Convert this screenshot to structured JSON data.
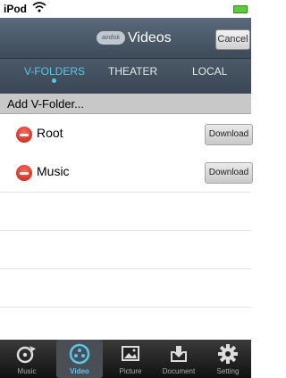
{
  "status": {
    "device": "iPod"
  },
  "nav": {
    "brand": "airdisk",
    "title": "Videos",
    "cancel": "Cancel"
  },
  "tabs": [
    {
      "label": "V-FOLDERS",
      "active": true
    },
    {
      "label": "THEATER",
      "active": false
    },
    {
      "label": "LOCAL",
      "active": false
    }
  ],
  "add_folder": "Add V-Folder...",
  "folders": [
    {
      "name": "Root",
      "action": "Download"
    },
    {
      "name": "Music",
      "action": "Download"
    }
  ],
  "tabbar": [
    {
      "label": "Music",
      "icon": "music-icon"
    },
    {
      "label": "Video",
      "icon": "video-icon",
      "active": true
    },
    {
      "label": "Picture",
      "icon": "picture-icon"
    },
    {
      "label": "Document",
      "icon": "document-icon"
    },
    {
      "label": "Setting",
      "icon": "gear-icon"
    }
  ],
  "colors": {
    "accent": "#56c8ec",
    "delete": "#e0281c"
  }
}
